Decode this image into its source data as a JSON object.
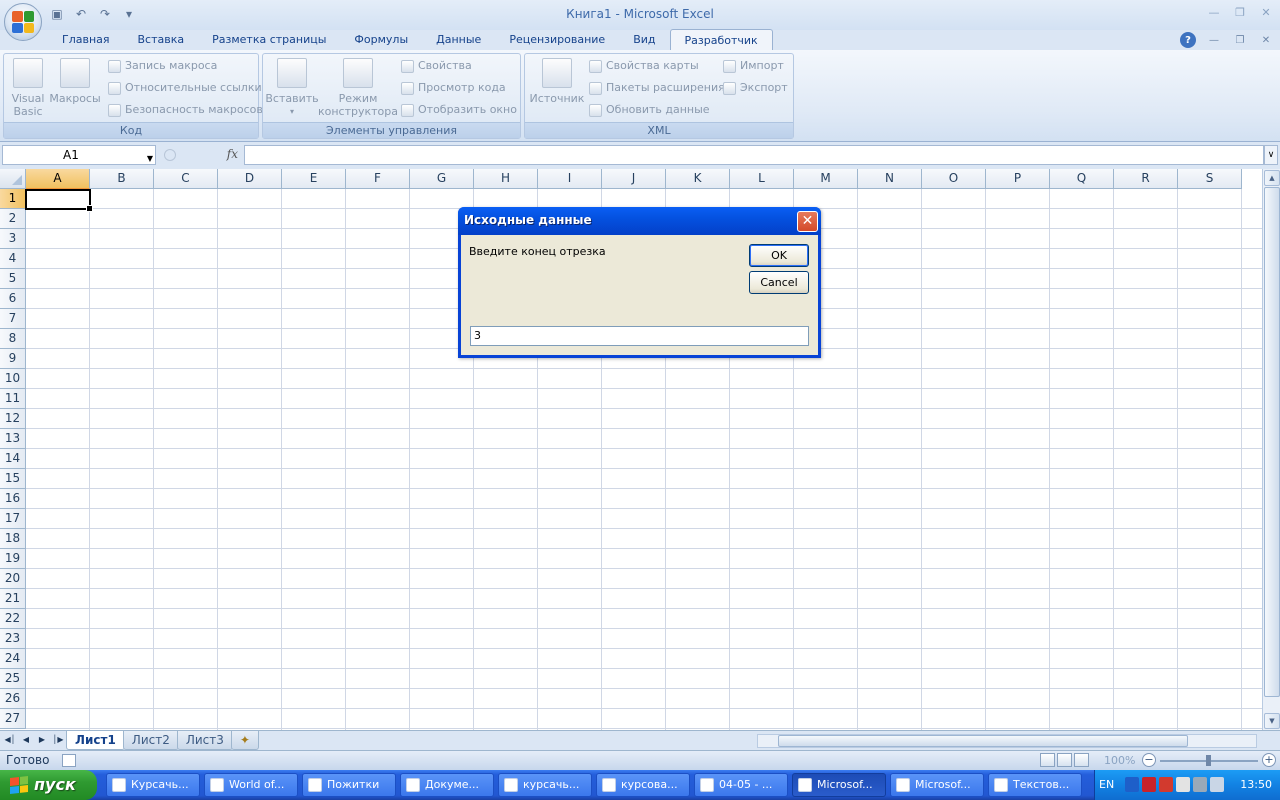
{
  "window": {
    "title": "Книга1 - Microsoft Excel"
  },
  "ribbon": {
    "tabs": [
      "Главная",
      "Вставка",
      "Разметка страницы",
      "Формулы",
      "Данные",
      "Рецензирование",
      "Вид",
      "Разработчик"
    ],
    "active_tab": "Разработчик",
    "groups": {
      "code": {
        "label": "Код",
        "visual_basic": "Visual\nBasic",
        "macros": "Макросы",
        "record_macro": "Запись макроса",
        "relative_refs": "Относительные ссылки",
        "macro_security": "Безопасность макросов"
      },
      "controls": {
        "label": "Элементы управления",
        "insert": "Вставить",
        "design_mode": "Режим\nконструктора",
        "properties": "Свойства",
        "view_code": "Просмотр кода",
        "show_window": "Отобразить окно"
      },
      "xml": {
        "label": "XML",
        "source": "Источник",
        "map_properties": "Свойства карты",
        "expansion_packs": "Пакеты расширения",
        "refresh_data": "Обновить данные",
        "import": "Импорт",
        "export": "Экспорт"
      }
    }
  },
  "formula_bar": {
    "name_box": "A1",
    "fx": "fx",
    "value": ""
  },
  "grid": {
    "columns": [
      "A",
      "B",
      "C",
      "D",
      "E",
      "F",
      "G",
      "H",
      "I",
      "J",
      "K",
      "L",
      "M",
      "N",
      "O",
      "P",
      "Q",
      "R",
      "S"
    ],
    "rows": [
      "1",
      "2",
      "3",
      "4",
      "5",
      "6",
      "7",
      "8",
      "9",
      "10",
      "11",
      "12",
      "13",
      "14",
      "15",
      "16",
      "17",
      "18",
      "19",
      "20",
      "21",
      "22",
      "23",
      "24",
      "25",
      "26",
      "27"
    ],
    "selected_column": "A",
    "selected_row": "1"
  },
  "sheets": {
    "tabs": [
      "Лист1",
      "Лист2",
      "Лист3"
    ],
    "active": "Лист1"
  },
  "status_bar": {
    "status": "Готово",
    "zoom": "100%"
  },
  "dialog": {
    "title": "Исходные данные",
    "prompt": "Введите конец отрезка",
    "ok_label": "OK",
    "cancel_label": "Cancel",
    "input_value": "3"
  },
  "taskbar": {
    "start_label": "пуск",
    "items": [
      {
        "label": "Курсачь...",
        "active": false
      },
      {
        "label": "World of...",
        "active": false
      },
      {
        "label": "Пожитки",
        "active": false
      },
      {
        "label": "Докуме...",
        "active": false
      },
      {
        "label": "курсачь...",
        "active": false
      },
      {
        "label": "курсова...",
        "active": false
      },
      {
        "label": "04-05 - ...",
        "active": false
      },
      {
        "label": "Microsof...",
        "active": true
      },
      {
        "label": "Microsof...",
        "active": false
      },
      {
        "label": "Текстов...",
        "active": false
      }
    ],
    "language": "EN",
    "clock": "13:50"
  },
  "colors": {
    "accent": "#15428b",
    "dialog_title": "#0451e0",
    "start_button": "#2f9a31",
    "selection": "#f1c15f"
  }
}
